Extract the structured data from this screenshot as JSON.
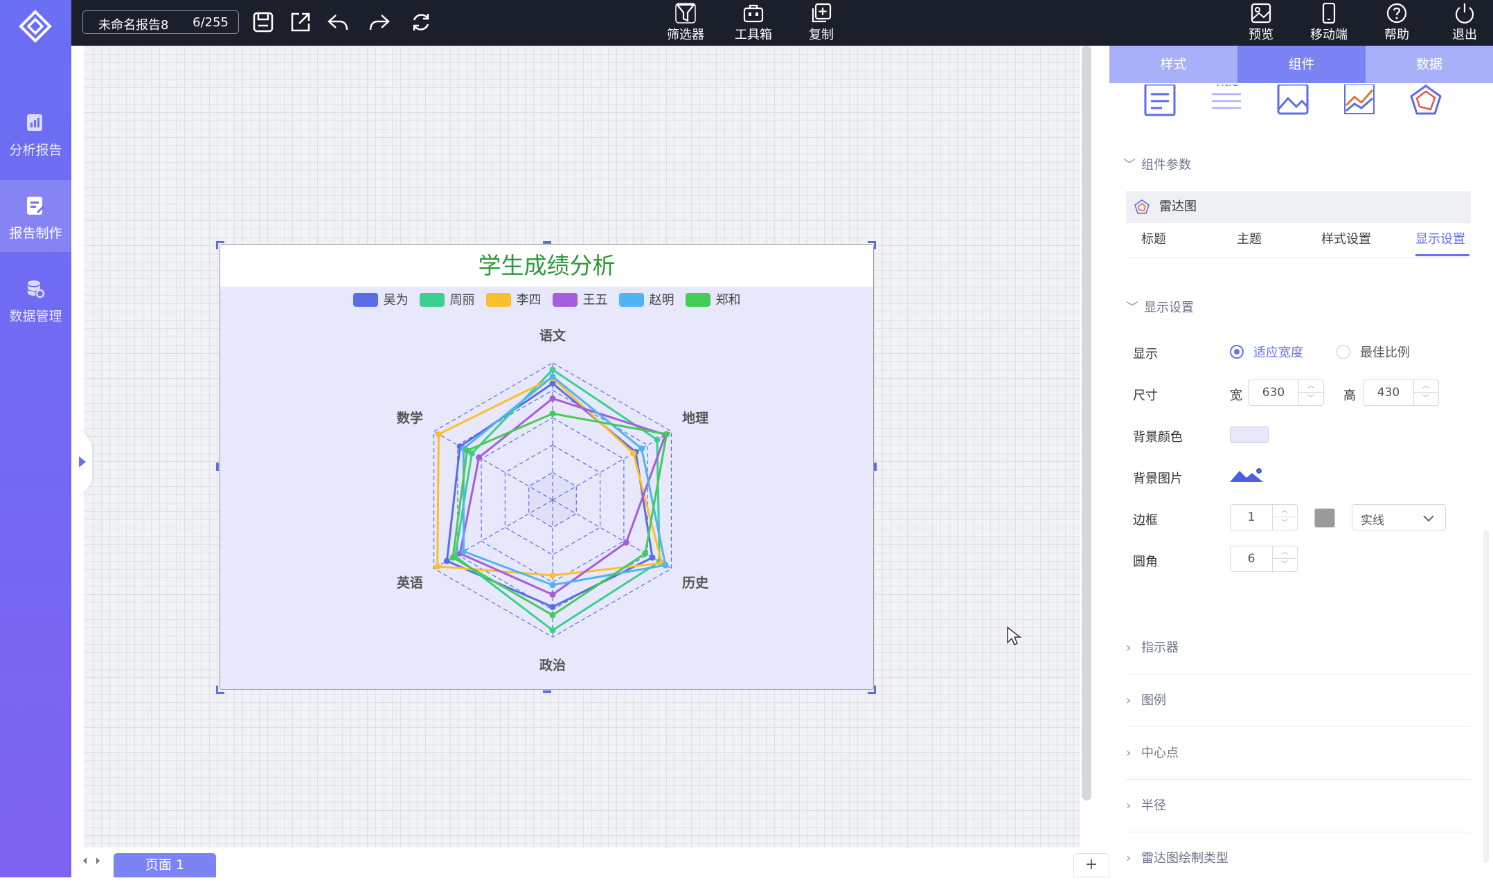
{
  "sidebar": {
    "items": [
      {
        "label": "分析报告",
        "icon": "analysis-report-icon"
      },
      {
        "label": "报告制作",
        "icon": "report-edit-icon",
        "active": true
      },
      {
        "label": "数据管理",
        "icon": "database-settings-icon"
      }
    ]
  },
  "topbar": {
    "report_name": "未命名报告8",
    "report_count": "6/255",
    "tools": [
      "save-icon",
      "export-icon",
      "undo-icon",
      "redo-icon",
      "refresh-icon"
    ],
    "center_buttons": [
      {
        "label": "筛选器",
        "icon": "filter-icon"
      },
      {
        "label": "工具箱",
        "icon": "toolbox-icon"
      },
      {
        "label": "复制",
        "icon": "copy-icon"
      }
    ],
    "right_buttons": [
      {
        "label": "预览",
        "icon": "preview-icon"
      },
      {
        "label": "移动端",
        "icon": "mobile-icon"
      },
      {
        "label": "帮助",
        "icon": "help-icon"
      },
      {
        "label": "退出",
        "icon": "power-icon"
      }
    ]
  },
  "widget": {
    "title": "学生成绩分析",
    "title_color": "#2a9a3a",
    "background": "#e7e8fb"
  },
  "chart_data": {
    "type": "radar",
    "title": "学生成绩分析",
    "indicators": [
      "语文",
      "地理",
      "历史",
      "政治",
      "英语",
      "数学"
    ],
    "max": 100,
    "series": [
      {
        "name": "吴为",
        "color": "#5b6de6",
        "values": [
          85,
          70,
          84,
          78,
          89,
          78
        ]
      },
      {
        "name": "周丽",
        "color": "#3ccf8e",
        "values": [
          95,
          88,
          90,
          95,
          82,
          68
        ]
      },
      {
        "name": "李四",
        "color": "#fbbf2e",
        "values": [
          89,
          68,
          92,
          55,
          97,
          96
        ]
      },
      {
        "name": "王五",
        "color": "#a45ddf",
        "values": [
          74,
          95,
          62,
          69,
          78,
          62
        ]
      },
      {
        "name": "赵明",
        "color": "#4fb3f5",
        "values": [
          90,
          75,
          95,
          62,
          75,
          75
        ]
      },
      {
        "name": "郑和",
        "color": "#44cc55",
        "values": [
          63,
          96,
          78,
          84,
          84,
          72
        ]
      }
    ]
  },
  "page_tabs": {
    "current": "页面 1",
    "add": "+"
  },
  "right_panel": {
    "tabs": [
      {
        "label": "样式"
      },
      {
        "label": "组件",
        "active": true
      },
      {
        "label": "数据"
      }
    ],
    "component_icons": [
      "text-block-icon",
      "title-text-icon",
      "image-icon",
      "line-chart-icon",
      "radar-chart-icon"
    ],
    "params_header": "组件参数",
    "selected_component": "雷达图",
    "sub_tabs": [
      {
        "label": "标题"
      },
      {
        "label": "主题"
      },
      {
        "label": "样式设置"
      },
      {
        "label": "显示设置",
        "active": true
      }
    ],
    "display_header": "显示设置",
    "display": {
      "label": "显示",
      "option_fit": "适应宽度",
      "option_best": "最佳比例"
    },
    "size": {
      "label": "尺寸",
      "w_label": "宽",
      "w": "630",
      "h_label": "高",
      "h": "430"
    },
    "bg_color": {
      "label": "背景颜色",
      "value": "#e7e8fb"
    },
    "bg_image": {
      "label": "背景图片"
    },
    "border": {
      "label": "边框",
      "width": "1",
      "color": "#9a9a9a",
      "style": "实线"
    },
    "radius": {
      "label": "圆角",
      "value": "6"
    },
    "collapsed_sections": [
      "指示器",
      "图例",
      "中心点",
      "半径",
      "雷达图绘制类型"
    ]
  }
}
